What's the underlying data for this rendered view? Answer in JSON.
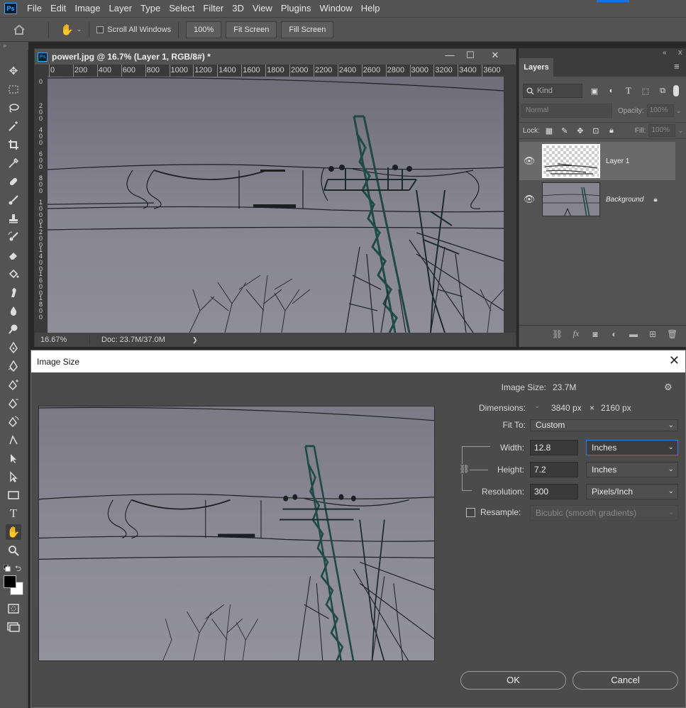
{
  "menu": {
    "logo": "Ps",
    "items": [
      "File",
      "Edit",
      "Image",
      "Layer",
      "Type",
      "Select",
      "Filter",
      "3D",
      "View",
      "Plugins",
      "Window",
      "Help"
    ]
  },
  "options_bar": {
    "scroll_all_windows": "Scroll All Windows",
    "zoom_100": "100%",
    "fit_screen": "Fit Screen",
    "fill_screen": "Fill Screen"
  },
  "left_collapse": "»",
  "document": {
    "title": "powerl.jpg @ 16.7% (Layer 1, RGB/8#) *",
    "ruler_h": [
      "0",
      "200",
      "400",
      "600",
      "800",
      "1000",
      "1200",
      "1400",
      "1600",
      "1800",
      "2000",
      "2200",
      "2400",
      "2600",
      "2800",
      "3000",
      "3200",
      "3400",
      "3600",
      "3"
    ],
    "ruler_v": [
      "0",
      "200",
      "400",
      "600",
      "800",
      "1000",
      "1200",
      "1400",
      "1600",
      "1800"
    ],
    "zoom": "16.67%",
    "doc_info": "Doc: 23.7M/37.0M",
    "status_arrow": "❯"
  },
  "layers_panel": {
    "tab": "Layers",
    "collapse": "«",
    "close": "x",
    "kind_placeholder": "Kind",
    "blend_mode": "Normal",
    "opacity_label": "Opacity:",
    "opacity_value": "100%",
    "lock_label": "Lock:",
    "fill_label": "Fill:",
    "fill_value": "100%",
    "layers": [
      {
        "name": "Layer 1",
        "selected": true
      },
      {
        "name": "Background",
        "selected": false
      }
    ]
  },
  "image_size_dialog": {
    "title": "Image Size",
    "image_size_label": "Image Size:",
    "image_size_value": "23.7M",
    "dimensions_label": "Dimensions:",
    "dim_width": "3840 px",
    "dim_x": "×",
    "dim_height": "2160 px",
    "fit_to_label": "Fit To:",
    "fit_to_value": "Custom",
    "width_label": "Width:",
    "width_value": "12.8",
    "width_unit": "Inches",
    "height_label": "Height:",
    "height_value": "7.2",
    "height_unit": "Inches",
    "resolution_label": "Resolution:",
    "resolution_value": "300",
    "resolution_unit": "Pixels/Inch",
    "resample_label": "Resample:",
    "resample_value": "Bicubic (smooth gradients)",
    "ok": "OK",
    "cancel": "Cancel"
  },
  "colors": {
    "accent": "#1473e6",
    "sky": "#84838f",
    "tower": "#1f4a45"
  }
}
